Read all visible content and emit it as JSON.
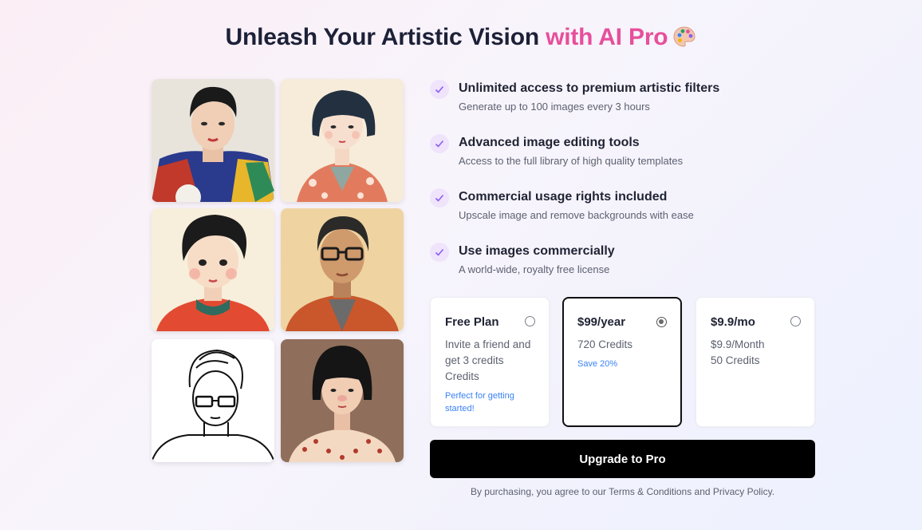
{
  "header": {
    "title_main": "Unleash Your Artistic Vision ",
    "title_accent": "with AI Pro",
    "title_icon": "palette-icon"
  },
  "gallery": {
    "tiles": [
      {
        "name": "portrait-colorful-jacket"
      },
      {
        "name": "portrait-girl-floral-kimono"
      },
      {
        "name": "portrait-boy-cartoon"
      },
      {
        "name": "portrait-man-glasses"
      },
      {
        "name": "portrait-line-sketch"
      },
      {
        "name": "portrait-girl-polka-dot"
      }
    ]
  },
  "features": [
    {
      "title": "Unlimited access to premium artistic filters",
      "desc": "Generate up to 100 images every 3 hours"
    },
    {
      "title": "Advanced image editing tools",
      "desc": "Access to the full library of high quality templates"
    },
    {
      "title": "Commercial usage rights included",
      "desc": "Upscale image and remove backgrounds with ease"
    },
    {
      "title": "Use images commercially",
      "desc": "A world-wide, royalty free license"
    }
  ],
  "plans": [
    {
      "name": "Free Plan",
      "line1": "Invite a friend and get 3 credits Credits",
      "line2": "",
      "note": "Perfect for getting started!",
      "selected": false
    },
    {
      "name": "$99/year",
      "line1": "720 Credits",
      "line2": "",
      "note": "Save 20%",
      "selected": true
    },
    {
      "name": "$9.9/mo",
      "line1": "$9.9/Month",
      "line2": "50 Credits",
      "note": "",
      "selected": false
    }
  ],
  "cta": {
    "label": "Upgrade to Pro"
  },
  "legal": {
    "text": "By purchasing, you agree to our Terms & Conditions and Privacy Policy."
  },
  "colors": {
    "accent": "#e64f9b",
    "check_bg": "#efe4fb",
    "check_mark": "#8b5cf6",
    "note_blue": "#3b82f6",
    "cta_bg": "#000000"
  }
}
